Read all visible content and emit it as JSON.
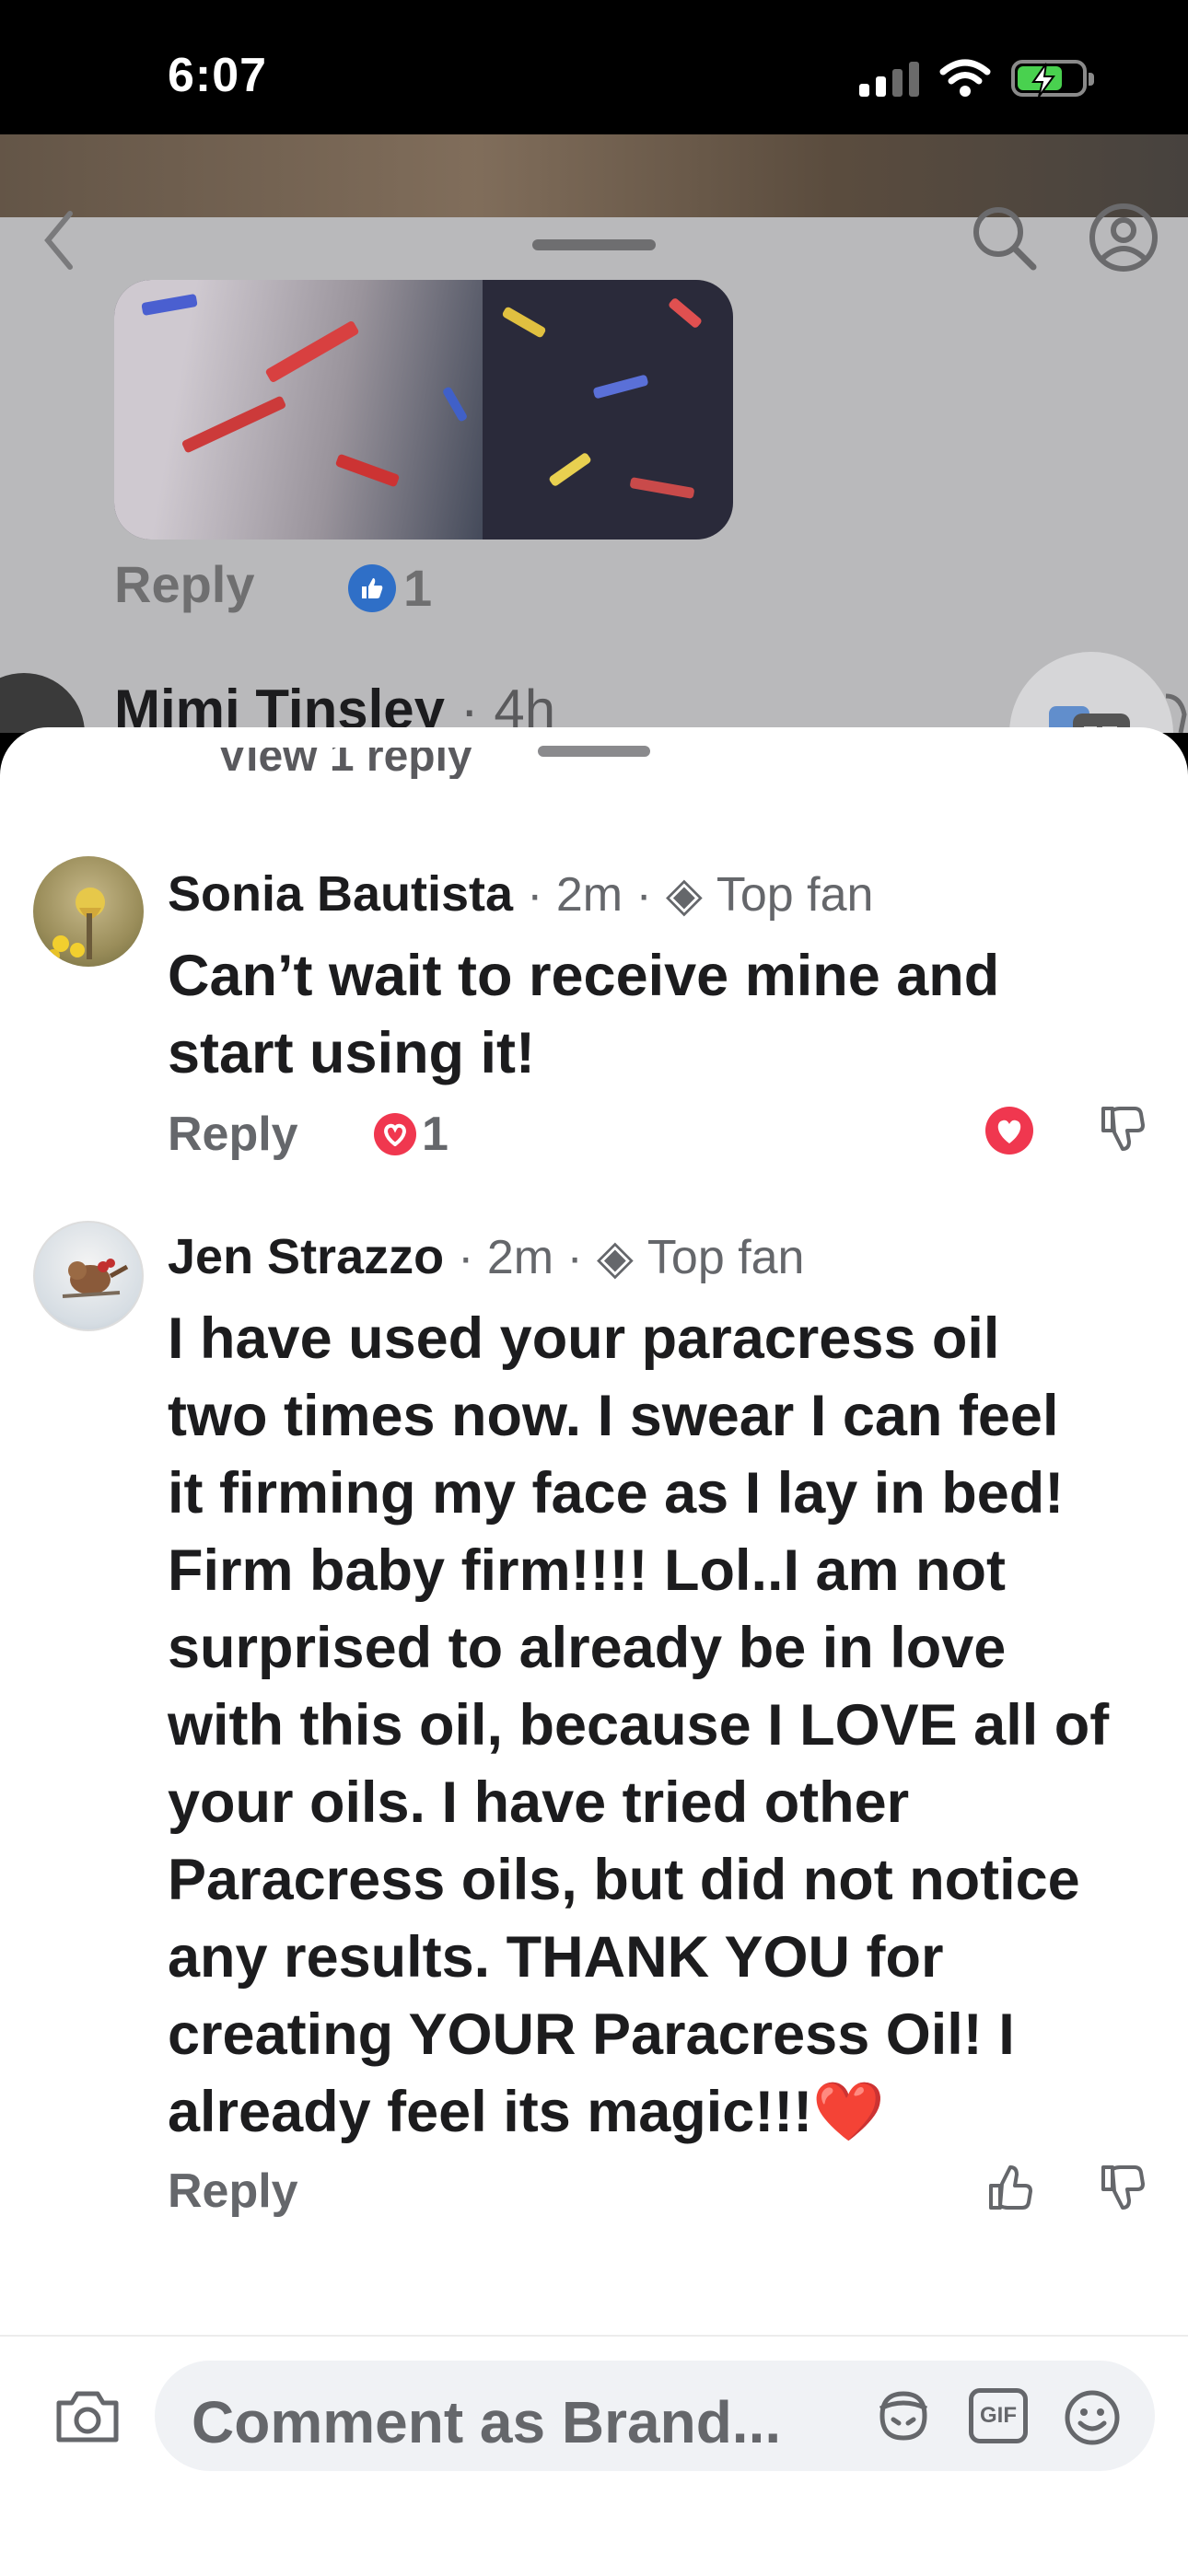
{
  "status": {
    "time": "6:07"
  },
  "background_post": {
    "reply_label": "Reply",
    "like_count": "1",
    "next_commenter": "Mimi Tinsley",
    "next_time": "· 4h",
    "view_replies": "View 1 reply"
  },
  "comments": [
    {
      "name": "Sonia Bautista",
      "time": "· 2m ·",
      "badge": "Top fan",
      "lines": [
        "Can’t wait to receive mine and",
        "start using it!"
      ],
      "reply_label": "Reply",
      "reaction_count": "1",
      "reaction_type": "heart"
    },
    {
      "name": "Jen Strazzo",
      "time": "· 2m ·",
      "badge": "Top fan",
      "lines": [
        "I have used your paracress oil",
        "two times now. I swear I can feel",
        "it firming my face as I lay in bed!",
        "Firm baby firm!!!! Lol..I am not",
        "surprised to already be in love",
        "with this oil, because I LOVE all of",
        "your oils. I have tried other",
        "Paracress oils, but did not notice",
        "any results. THANK YOU for",
        "creating YOUR Paracress Oil! I",
        "already feel its magic!!!❤️"
      ],
      "reply_label": "Reply"
    }
  ],
  "composer": {
    "placeholder": "Comment as Brand...",
    "gif_label": "GIF"
  },
  "colors": {
    "accent_blue": "#2f6fc7",
    "heart_red": "#f0374f",
    "text_gray": "#65676b"
  }
}
